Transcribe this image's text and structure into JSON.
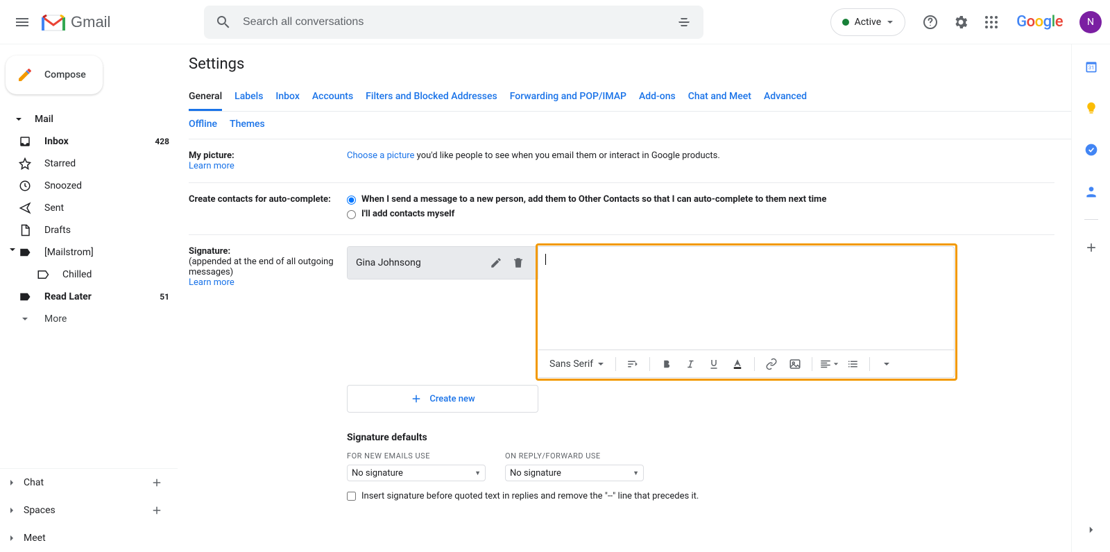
{
  "header": {
    "search_placeholder": "Search all conversations",
    "status_label": "Active",
    "avatar_initial": "N"
  },
  "compose_label": "Compose",
  "sidebar": {
    "mail_label": "Mail",
    "items": [
      {
        "label": "Inbox",
        "count": "428",
        "bold": true,
        "icon": "inbox"
      },
      {
        "label": "Starred",
        "icon": "star"
      },
      {
        "label": "Snoozed",
        "icon": "clock"
      },
      {
        "label": "Sent",
        "icon": "send"
      },
      {
        "label": "Drafts",
        "icon": "file"
      },
      {
        "label": "[Mailstrom]",
        "icon": "label",
        "expandable": true
      },
      {
        "label": "Chilled",
        "icon": "label",
        "indent": true
      },
      {
        "label": "Read Later",
        "count": "51",
        "bold": true,
        "icon": "label"
      }
    ],
    "more_label": "More",
    "sections": [
      {
        "label": "Chat"
      },
      {
        "label": "Spaces"
      },
      {
        "label": "Meet"
      }
    ]
  },
  "page": {
    "title": "Settings",
    "tabs_primary": [
      "General",
      "Labels",
      "Inbox",
      "Accounts",
      "Filters and Blocked Addresses",
      "Forwarding and POP/IMAP",
      "Add-ons",
      "Chat and Meet",
      "Advanced"
    ],
    "tabs_secondary": [
      "Offline",
      "Themes"
    ],
    "active_tab": "General"
  },
  "settings": {
    "picture": {
      "label": "My picture:",
      "learn_more": "Learn more",
      "choose_link": "Choose a picture",
      "desc_suffix": " you'd like people to see when you email them or interact in Google products."
    },
    "contacts": {
      "label": "Create contacts for auto-complete:",
      "option1": "When I send a message to a new person, add them to Other Contacts so that I can auto-complete to them next time",
      "option2": "I'll add contacts myself"
    },
    "signature": {
      "label": "Signature:",
      "sub": "(appended at the end of all outgoing messages)",
      "learn_more": "Learn more",
      "list": [
        {
          "name": "Gina Johnsong"
        }
      ],
      "create_new": "Create new",
      "font_label": "Sans Serif",
      "defaults_title": "Signature defaults",
      "for_new_label": "FOR NEW EMAILS USE",
      "on_reply_label": "ON REPLY/FORWARD USE",
      "for_new_value": "No signature",
      "on_reply_value": "No signature",
      "insert_checkbox": "Insert signature before quoted text in replies and remove the \"--\" line that precedes it."
    }
  }
}
